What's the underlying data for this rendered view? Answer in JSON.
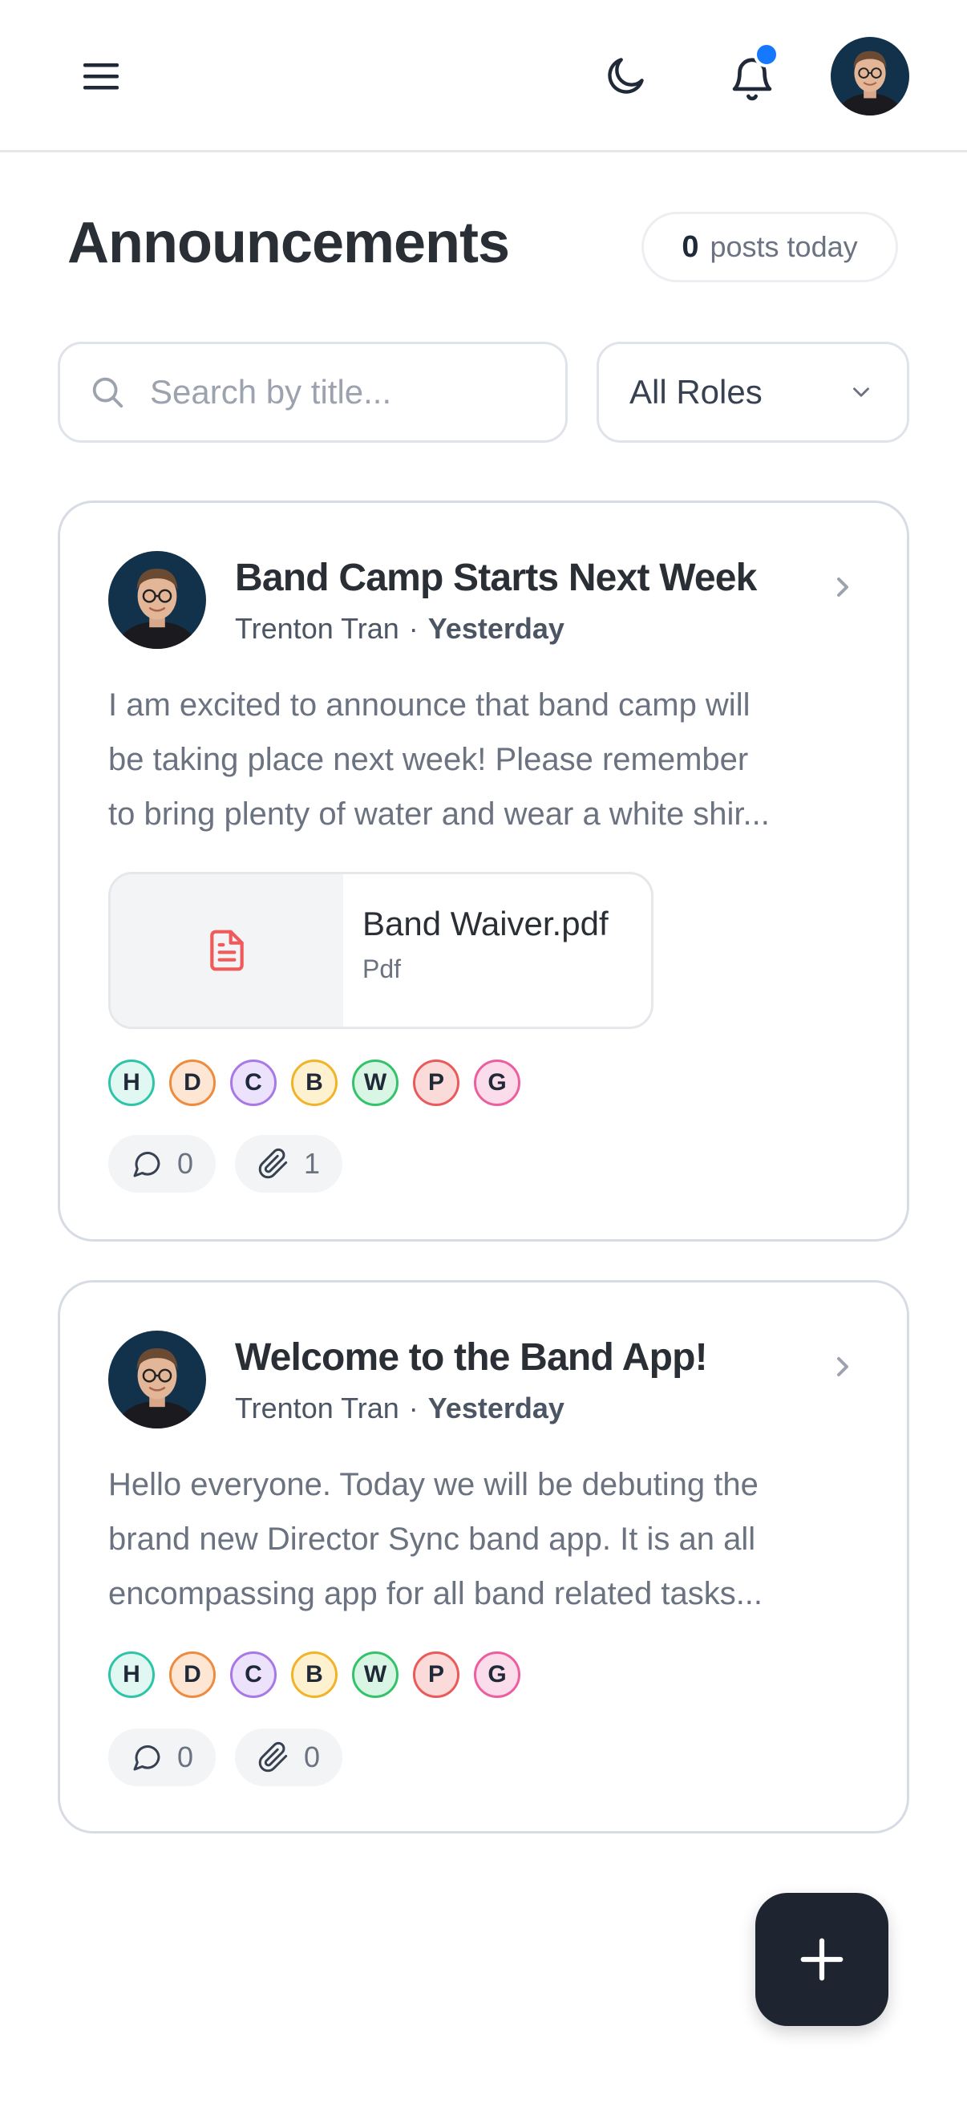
{
  "header": {
    "menu_icon": "hamburger-menu-icon",
    "theme_icon": "moon-icon",
    "notifications_icon": "bell-icon",
    "has_unread": true
  },
  "page": {
    "title": "Announcements",
    "posts_today_count": "0",
    "posts_today_label": "posts today"
  },
  "filters": {
    "search_placeholder": "Search by title...",
    "role_selected": "All Roles"
  },
  "announcements": [
    {
      "title": "Band Camp Starts Next Week",
      "author": "Trenton Tran",
      "separator": "·",
      "when": "Yesterday",
      "body_lines": [
        "I am excited to announce that band camp will",
        "be taking place next week! Please remember",
        "to bring plenty of water and wear a white shir..."
      ],
      "attachment": {
        "name": "Band Waiver.pdf",
        "type": "Pdf"
      },
      "roles": [
        "H",
        "D",
        "C",
        "B",
        "W",
        "P",
        "G"
      ],
      "comments": "0",
      "attachments": "1"
    },
    {
      "title": "Welcome to the Band App!",
      "author": "Trenton Tran",
      "separator": "·",
      "when": "Yesterday",
      "body_lines": [
        "Hello everyone. Today we will be debuting the",
        "brand new Director Sync band app. It is an all",
        "encompassing app for all band related tasks..."
      ],
      "roles": [
        "H",
        "D",
        "C",
        "B",
        "W",
        "P",
        "G"
      ],
      "comments": "0",
      "attachments": "0"
    }
  ],
  "role_colors": {
    "H": {
      "border": "#2dc5a8",
      "bg": "#e0f7f2"
    },
    "D": {
      "border": "#f08a3c",
      "bg": "#fde6d3"
    },
    "C": {
      "border": "#a877e8",
      "bg": "#ede2fb"
    },
    "B": {
      "border": "#f0b429",
      "bg": "#fdf1cf"
    },
    "W": {
      "border": "#34c26a",
      "bg": "#d9f5e3"
    },
    "P": {
      "border": "#ea5a5a",
      "bg": "#fbdada"
    },
    "G": {
      "border": "#ec5ea0",
      "bg": "#fbdcea"
    }
  },
  "fab_icon": "plus-icon"
}
